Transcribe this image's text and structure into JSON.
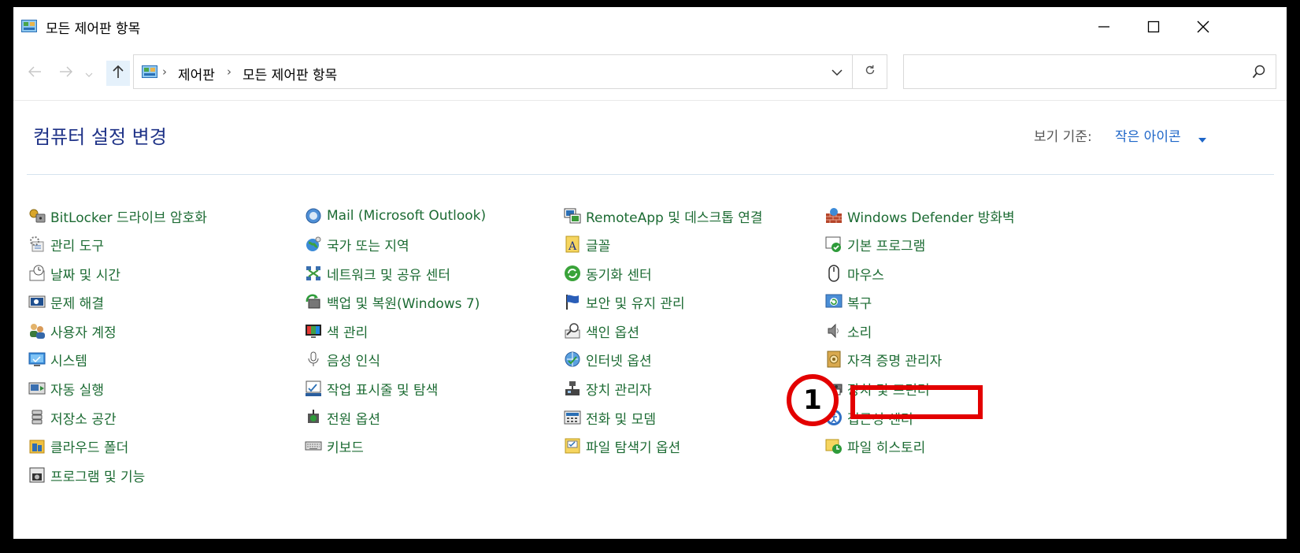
{
  "window": {
    "title": "모든 제어판 항목",
    "controls": {
      "minimize": "minimize-icon",
      "maximize": "maximize-icon",
      "close": "close-icon"
    }
  },
  "address": {
    "crumbs": [
      "제어판",
      "모든 제어판 항목"
    ],
    "search_placeholder": ""
  },
  "header": {
    "title": "컴퓨터 설정 변경",
    "view_label": "보기 기준:",
    "view_value": "작은 아이콘"
  },
  "items": [
    {
      "label": "BitLocker 드라이브 암호화",
      "icon": "bitlocker-icon"
    },
    {
      "label": "관리 도구",
      "icon": "admin-tools-icon"
    },
    {
      "label": "날짜 및 시간",
      "icon": "date-time-icon"
    },
    {
      "label": "문제 해결",
      "icon": "troubleshoot-icon"
    },
    {
      "label": "사용자 계정",
      "icon": "user-accounts-icon"
    },
    {
      "label": "시스템",
      "icon": "system-icon"
    },
    {
      "label": "자동 실행",
      "icon": "autoplay-icon"
    },
    {
      "label": "저장소 공간",
      "icon": "storage-spaces-icon"
    },
    {
      "label": "클라우드 폴더",
      "icon": "work-folders-icon"
    },
    {
      "label": "프로그램 및 기능",
      "icon": "programs-features-icon"
    },
    {
      "label": "Mail (Microsoft Outlook)",
      "icon": "mail-icon"
    },
    {
      "label": "국가 또는 지역",
      "icon": "region-icon"
    },
    {
      "label": "네트워크 및 공유 센터",
      "icon": "network-icon"
    },
    {
      "label": "백업 및 복원(Windows 7)",
      "icon": "backup-icon"
    },
    {
      "label": "색 관리",
      "icon": "color-management-icon"
    },
    {
      "label": "음성 인식",
      "icon": "speech-icon"
    },
    {
      "label": "작업 표시줄 및 탐색",
      "icon": "taskbar-icon"
    },
    {
      "label": "전원 옵션",
      "icon": "power-icon"
    },
    {
      "label": "키보드",
      "icon": "keyboard-icon"
    },
    {
      "label": "RemoteApp 및 데스크톱 연결",
      "icon": "remoteapp-icon"
    },
    {
      "label": "글꼴",
      "icon": "fonts-icon"
    },
    {
      "label": "동기화 센터",
      "icon": "sync-icon"
    },
    {
      "label": "보안 및 유지 관리",
      "icon": "security-flag-icon"
    },
    {
      "label": "색인 옵션",
      "icon": "indexing-icon"
    },
    {
      "label": "인터넷 옵션",
      "icon": "internet-icon"
    },
    {
      "label": "장치 관리자",
      "icon": "device-manager-icon"
    },
    {
      "label": "전화 및 모뎀",
      "icon": "phone-modem-icon"
    },
    {
      "label": "파일 탐색기 옵션",
      "icon": "explorer-options-icon"
    },
    {
      "label": "Windows Defender 방화벽",
      "icon": "firewall-icon"
    },
    {
      "label": "기본 프로그램",
      "icon": "default-programs-icon"
    },
    {
      "label": "마우스",
      "icon": "mouse-icon"
    },
    {
      "label": "복구",
      "icon": "recovery-icon"
    },
    {
      "label": "소리",
      "icon": "sound-icon"
    },
    {
      "label": "자격 증명 관리자",
      "icon": "credential-icon"
    },
    {
      "label": "장치 및 프린터",
      "icon": "devices-printers-icon"
    },
    {
      "label": "접근성 센터",
      "icon": "ease-of-access-icon"
    },
    {
      "label": "파일 히스토리",
      "icon": "file-history-icon"
    }
  ],
  "annotation": {
    "number": "1",
    "color": "#e30000"
  },
  "colors": {
    "link": "#1c6b33",
    "heading": "#1e3287",
    "accent": "#1e66c8"
  }
}
